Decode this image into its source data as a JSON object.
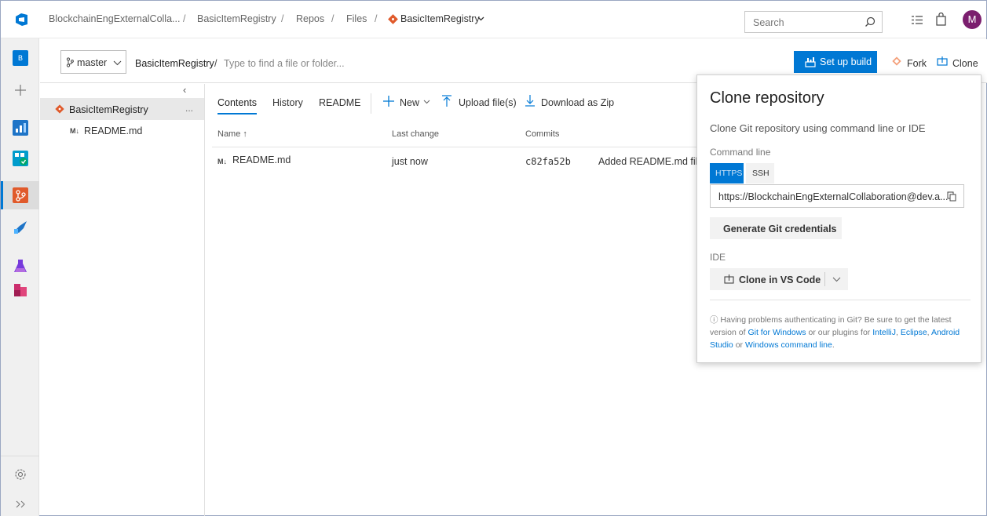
{
  "breadcrumb": {
    "organization": "BlockchainEngExternalColla...",
    "project": "BasicItemRegistry",
    "section": "Repos",
    "page": "Files",
    "repo": "BasicItemRegistry"
  },
  "search": {
    "placeholder": "Search"
  },
  "user": {
    "initial": "M"
  },
  "leftnav": {
    "project_badge": "B"
  },
  "subbar": {
    "branch": "master",
    "path_root": "BasicItemRegistry",
    "path_separator": "/",
    "path_placeholder": "Type to find a file or folder...",
    "setup_build": "Set up build",
    "fork": "Fork",
    "clone": "Clone"
  },
  "tree": {
    "root": "BasicItemRegistry",
    "more": "...",
    "collapse": "‹",
    "items": [
      {
        "badge": "M↓",
        "name": "README.md"
      }
    ]
  },
  "content": {
    "tabs": [
      "Contents",
      "History",
      "README"
    ],
    "actions": {
      "new": "New",
      "upload": "Upload file(s)",
      "download": "Download as Zip"
    },
    "columns": {
      "name": "Name ↑",
      "last_change": "Last change",
      "commits": "Commits"
    },
    "rows": [
      {
        "badge": "M↓",
        "name": "README.md",
        "last_change": "just now",
        "commit": "c82fa52b",
        "message": "Added README.md file"
      }
    ]
  },
  "clone_panel": {
    "title": "Clone repository",
    "subtitle": "Clone Git repository using command line or IDE",
    "command_line_label": "Command line",
    "protocols": [
      "HTTPS",
      "SSH"
    ],
    "selected_protocol": "HTTPS",
    "url": "https://BlockchainEngExternalCollaboration@dev.a...",
    "generate_credentials": "Generate Git credentials",
    "ide_label": "IDE",
    "clone_in_vscode": "Clone in VS Code",
    "help": {
      "part1": "Having problems authenticating in Git? Be sure to get the latest version of",
      "link_git_windows": "Git for Windows",
      "part2": "or our plugins for",
      "link_intellij": "IntelliJ",
      "link_eclipse": "Eclipse",
      "link_android": "Android Studio",
      "part3": "or",
      "link_cmd": "Windows command line"
    }
  },
  "colors": {
    "accent": "#0078d4",
    "git_red": "#e05a2b",
    "avatar": "#7b1e6e"
  }
}
